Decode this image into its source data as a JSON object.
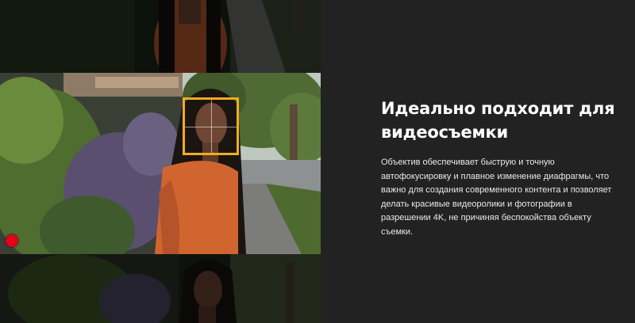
{
  "section": {
    "title": "Идеально подходит для видеосъемки",
    "description": "Объектив обеспечивает быструю и точную автофокусировку и плавное изменение диафрагмы, что важно для создания современного контента и позволяет делать красивые видеоролики и фотографии в разрешении 4K, не причиняя беспокойства объекту съемки."
  },
  "colors": {
    "panel_background": "#222222",
    "focus_frame": "#f1ad1c",
    "record_indicator": "#e3001b"
  },
  "icons": {
    "focus": "autofocus-frame-icon",
    "record": "record-dot-icon"
  }
}
